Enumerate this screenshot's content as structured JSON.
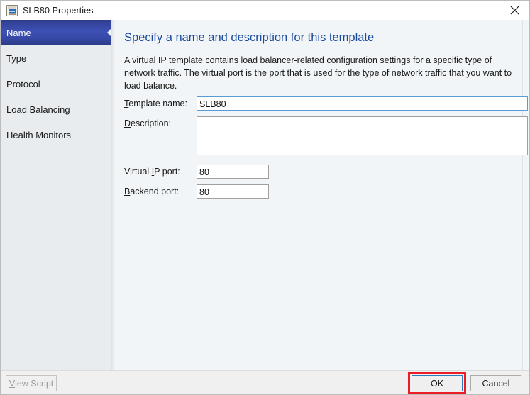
{
  "window": {
    "title": "SLB80 Properties",
    "icon": "template-window-icon",
    "close_label": "✕"
  },
  "sidebar": {
    "items": [
      {
        "label": "Name",
        "selected": true
      },
      {
        "label": "Type",
        "selected": false
      },
      {
        "label": "Protocol",
        "selected": false
      },
      {
        "label": "Load Balancing",
        "selected": false
      },
      {
        "label": "Health Monitors",
        "selected": false
      }
    ]
  },
  "main": {
    "heading": "Specify a name and description for this template",
    "description": "A virtual IP template contains load balancer-related configuration settings for a specific type of network traffic. The virtual port is the port that is used for the type of network traffic that you want to load balance.",
    "fields": {
      "template_name": {
        "label_prefix": "",
        "label_accesskey": "T",
        "label_suffix": "emplate name:",
        "value": "SLB80",
        "placeholder": "",
        "focused": true
      },
      "description": {
        "label_prefix": "",
        "label_accesskey": "D",
        "label_suffix": "escription:",
        "value": "",
        "placeholder": "",
        "focused": false
      },
      "virtual_ip_port": {
        "label_prefix": "Virtual ",
        "label_accesskey": "I",
        "label_suffix": "P port:",
        "value": "80",
        "placeholder": "",
        "focused": false
      },
      "backend_port": {
        "label_prefix": "",
        "label_accesskey": "B",
        "label_suffix": "ackend port:",
        "value": "80",
        "placeholder": "",
        "focused": false
      }
    }
  },
  "footer": {
    "view_script": {
      "label_prefix": "",
      "label_accesskey": "V",
      "label_suffix": "iew Script",
      "disabled": true
    },
    "ok_label": "OK",
    "cancel_label": "Cancel"
  },
  "colors": {
    "heading_blue": "#1a4a9c",
    "selection_blue": "#3d51b5",
    "focus_border": "#5b9bd5",
    "highlight_red": "#ec1c24",
    "panel_bg": "#f2f5f7",
    "sidebar_bg": "#e8ecef"
  }
}
